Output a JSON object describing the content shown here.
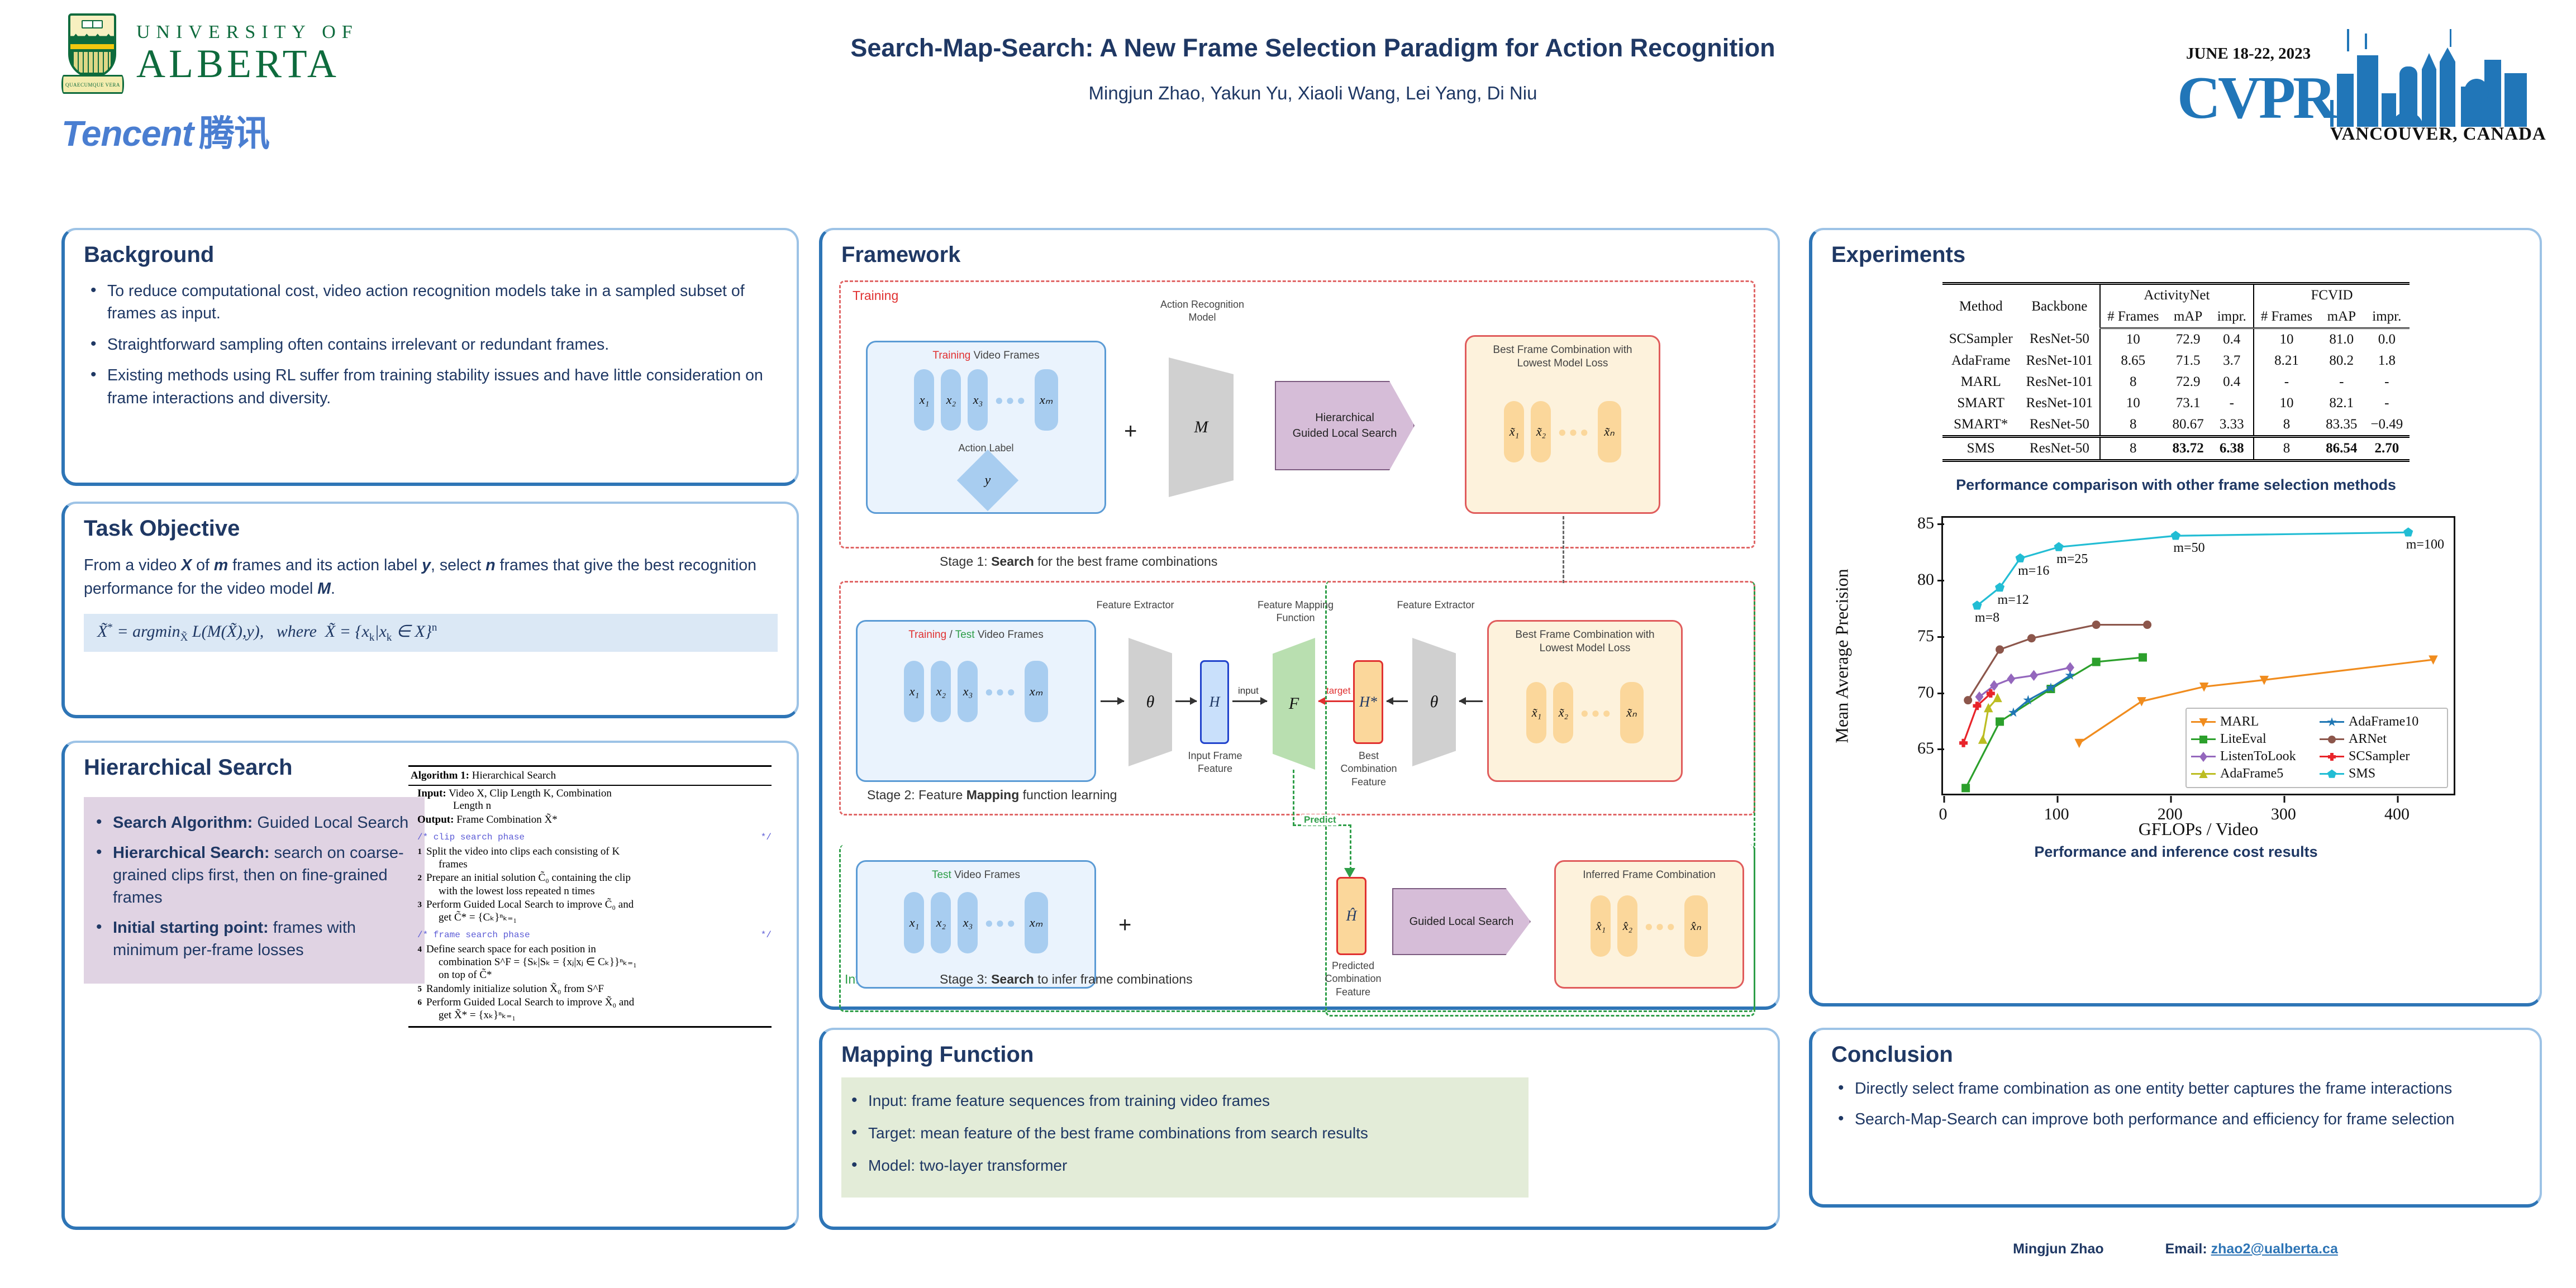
{
  "header": {
    "university": {
      "line1": "UNIVERSITY OF",
      "line2": "ALBERTA",
      "motto": "QUAECUMQUE VERA"
    },
    "company": {
      "latin": "Tencent",
      "chinese": "腾讯"
    },
    "title": "Search-Map-Search: A New Frame Selection Paradigm for Action Recognition",
    "authors": "Mingjun Zhao, Yakun Yu, Xiaoli Wang, Lei Yang, Di Niu",
    "conference": {
      "date": "JUNE 18-22, 2023",
      "name": "CVPR",
      "location": "VANCOUVER, CANADA"
    }
  },
  "background": {
    "title": "Background",
    "bullets": [
      "To reduce computational cost, video action recognition models take in a sampled subset of frames as input.",
      "Straightforward sampling often contains irrelevant or redundant frames.",
      "Existing methods using RL suffer from training stability issues and have little consideration on frame interactions and diversity."
    ]
  },
  "task_objective": {
    "title": "Task Objective",
    "text_parts": [
      "From a video ",
      "X",
      " of ",
      "m",
      " frames and its action label ",
      "y",
      ", select ",
      "n",
      " frames that give the best recognition performance for the video model ",
      "M",
      "."
    ],
    "equation": "X̃* = argmin_X̃ L(M(X̃), y),   where  X̃ = {x_k | x_k ∈ X}^n"
  },
  "hierarchical_search": {
    "title": "Hierarchical Search",
    "bullets": [
      {
        "label": "Search Algorithm:",
        "text": " Guided Local Search"
      },
      {
        "label": "Hierarchical Search:",
        "text": " search on coarse-grained clips first, then on fine-grained frames"
      },
      {
        "label": "Initial starting point:",
        "text": " frames with minimum per-frame losses"
      }
    ],
    "algorithm": {
      "heading_bold": "Algorithm 1:",
      "heading_rest": " Hierarchical Search",
      "input_label": "Input:",
      "input_line1": "Video X, Clip Length K, Combination",
      "input_line2": "Length n",
      "output_label": "Output:",
      "output_text": "Frame Combination X̃*",
      "comment_clip": "/* clip search phase",
      "comment_close": "*/",
      "comment_frame": "/* frame search phase",
      "steps": [
        {
          "num": "1",
          "line1": "Split the video into clips each consisting of K",
          "line2": "frames"
        },
        {
          "num": "2",
          "line1": "Prepare an initial solution C̃₀ containing the clip",
          "line2": "with the lowest loss repeated n times"
        },
        {
          "num": "3",
          "line1": "Perform Guided Local Search to improve C̃₀ and",
          "line2": "get C̃* = {Cₖ}ⁿₖ₌₁"
        },
        {
          "num": "4",
          "line1": "Define search space for each position in",
          "line2": "combination S^F = {Sₖ|Sₖ = {xⱼ|xⱼ ∈ Cₖ}}ⁿₖ₌₁",
          "line3": "on top of C̃*"
        },
        {
          "num": "5",
          "line1": "Randomly initialize solution X̃₀ from S^F",
          "line2": ""
        },
        {
          "num": "6",
          "line1": "Perform Guided Local Search to improve X̃₀ and",
          "line2": "get X̃* = {xₖ}ⁿₖ₌₁"
        }
      ]
    }
  },
  "framework": {
    "title": "Framework",
    "phase_training": "Training",
    "phase_inference": "Inference",
    "stage1": {
      "caption_prefix": "Stage 1: ",
      "caption_bold": "Search",
      "caption_suffix": " for the best frame combinations",
      "frames_title_red": "Training",
      "frames_title_rest": " Video Frames",
      "frames": [
        "x₁",
        "x₂",
        "x₃",
        "xₘ"
      ],
      "action_label_caption": "Action Label",
      "action_label": "y",
      "plus": "+",
      "model_caption": "Action Recognition Model",
      "model_symbol": "M",
      "search_block_line1": "Hierarchical",
      "search_block_line2": "Guided Local Search",
      "result_title_line1": "Best Frame Combination with",
      "result_title_line2": "Lowest Model Loss",
      "result_frames": [
        "x̃₁",
        "x̃₂",
        "x̃ₙ"
      ]
    },
    "stage2": {
      "caption_prefix": "Stage 2: Feature ",
      "caption_bold": "Mapping",
      "caption_suffix": " function learning",
      "frames_title_red": "Training",
      "frames_title_slash": " / ",
      "frames_title_green": "Test",
      "frames_title_rest": " Video Frames",
      "frames": [
        "x₁",
        "x₂",
        "x₃",
        "xₘ"
      ],
      "extractor_caption": "Feature Extractor",
      "extractor_symbol": "θ",
      "feature_symbol": "H",
      "feature_caption": "Input Frame Feature",
      "input_label": "input",
      "mapping_caption": "Feature Mapping Function",
      "mapping_symbol": "F",
      "target_label": "target",
      "target_symbol": "H*",
      "target_caption": "Best Combination Feature",
      "extractor2_caption": "Feature Extractor",
      "extractor2_symbol": "θ",
      "result_title_line1": "Best Frame Combination with",
      "result_title_line2": "Lowest Model Loss",
      "result_frames": [
        "x̃₁",
        "x̃₂",
        "x̃ₙ"
      ],
      "predict_label": "Predict"
    },
    "stage3": {
      "caption_prefix": "Stage 3: ",
      "caption_bold": "Search",
      "caption_suffix": " to infer frame combinations",
      "frames_title_green": "Test",
      "frames_title_rest": " Video Frames",
      "frames": [
        "x₁",
        "x₂",
        "x₃",
        "xₘ"
      ],
      "plus": "+",
      "predicted_symbol": "Ĥ",
      "predicted_caption": "Predicted Combination Feature",
      "search_block": "Guided Local Search",
      "result_title": "Inferred Frame Combination",
      "result_frames": [
        "x̂₁",
        "x̂₂",
        "x̂ₙ"
      ]
    }
  },
  "mapping_function": {
    "title": "Mapping Function",
    "bullets": [
      "Input: frame feature sequences from training video frames",
      "Target: mean feature of the best frame combinations from search results",
      "Model: two-layer transformer"
    ]
  },
  "experiments": {
    "title": "Experiments",
    "table": {
      "group_headers": [
        "ActivityNet",
        "FCVID"
      ],
      "columns": [
        "Method",
        "Backbone",
        "# Frames",
        "mAP",
        "impr.",
        "# Frames",
        "mAP",
        "impr."
      ],
      "rows": [
        [
          "SCSampler",
          "ResNet-50",
          "10",
          "72.9",
          "0.4",
          "10",
          "81.0",
          "0.0"
        ],
        [
          "AdaFrame",
          "ResNet-101",
          "8.65",
          "71.5",
          "3.7",
          "8.21",
          "80.2",
          "1.8"
        ],
        [
          "MARL",
          "ResNet-101",
          "8",
          "72.9",
          "0.4",
          "-",
          "-",
          "-"
        ],
        [
          "SMART",
          "ResNet-101",
          "10",
          "73.1",
          "-",
          "10",
          "82.1",
          "-"
        ],
        [
          "SMART*",
          "ResNet-50",
          "8",
          "80.67",
          "3.33",
          "8",
          "83.35",
          "−0.49"
        ]
      ],
      "highlight_row": [
        "SMS",
        "ResNet-50",
        "8",
        "83.72",
        "6.38",
        "8",
        "86.54",
        "2.70"
      ]
    },
    "table_caption": "Performance comparison with other frame selection methods",
    "chart_caption": "Performance and inference cost results"
  },
  "chart_data": {
    "type": "line",
    "title": "Performance and inference cost results",
    "xlabel": "GFLOPs / Video",
    "ylabel": "Mean Average Precision",
    "xlim": [
      0,
      450
    ],
    "ylim": [
      61,
      85.5
    ],
    "xticks": [
      0,
      100,
      200,
      300,
      400
    ],
    "yticks": [
      65,
      70,
      75,
      80,
      85
    ],
    "grid": false,
    "legend_position": "lower right",
    "series": [
      {
        "name": "MARL",
        "color": "#f08c1e",
        "marker": "triangle-down",
        "x": [
          120,
          175,
          230,
          283,
          432
        ],
        "y": [
          65.5,
          69.2,
          70.5,
          71.1,
          72.9
        ]
      },
      {
        "name": "LiteEval",
        "color": "#2ca02c",
        "marker": "square",
        "x": [
          20,
          50,
          95,
          135,
          176
        ],
        "y": [
          61.5,
          67.4,
          70.3,
          72.7,
          73.1
        ]
      },
      {
        "name": "ListenToLook",
        "color": "#9467bd",
        "marker": "diamond",
        "x": [
          32,
          45,
          60,
          80,
          112
        ],
        "y": [
          69.6,
          70.6,
          71.2,
          71.5,
          72.2
        ]
      },
      {
        "name": "AdaFrame5",
        "color": "#bcbd22",
        "marker": "triangle-up",
        "x": [
          35,
          40,
          48
        ],
        "y": [
          65.8,
          68.6,
          69.5
        ]
      },
      {
        "name": "AdaFrame10",
        "color": "#1f77b4",
        "marker": "star",
        "x": [
          62,
          75,
          95,
          112
        ],
        "y": [
          68.2,
          69.3,
          70.4,
          71.5
        ]
      },
      {
        "name": "ARNet",
        "color": "#8c564b",
        "marker": "circle",
        "x": [
          22,
          50,
          78,
          135,
          180
        ],
        "y": [
          69.3,
          73.8,
          74.8,
          76.0,
          76.0
        ]
      },
      {
        "name": "SCSampler",
        "color": "#e8242a",
        "marker": "plus",
        "x": [
          18,
          30,
          42
        ],
        "y": [
          65.5,
          68.8,
          69.9
        ]
      },
      {
        "name": "SMS",
        "color": "#22bdd4",
        "marker": "pentagon",
        "x": [
          30,
          50,
          68,
          102,
          205,
          410
        ],
        "y": [
          77.7,
          79.3,
          81.9,
          82.9,
          83.9,
          84.2
        ],
        "point_labels": [
          "m=8",
          "m=12",
          "m=16",
          "m=25",
          "m=50",
          "m=100"
        ]
      }
    ]
  },
  "conclusion": {
    "title": "Conclusion",
    "bullets": [
      "Directly select frame combination as one entity better captures the frame interactions",
      "Search-Map-Search can improve both performance and efficiency for frame selection"
    ]
  },
  "footer": {
    "name": "Mingjun Zhao",
    "email_label": "Email: ",
    "email": "zhao2@ualberta.ca"
  }
}
